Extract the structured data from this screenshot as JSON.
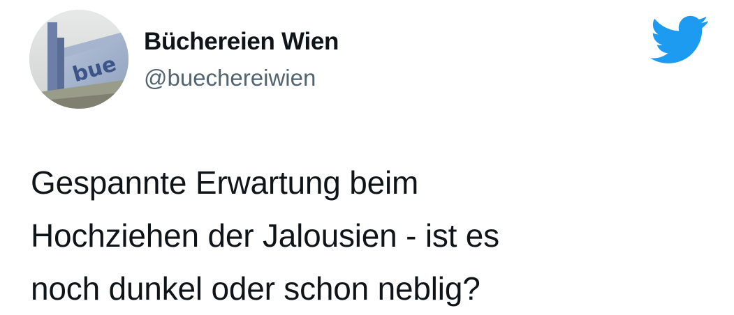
{
  "author": {
    "display_name": "Büchereien Wien",
    "handle": "@buechereiwien"
  },
  "tweet": {
    "lines": [
      "Gespannte Erwartung beim",
      "Hochziehen der Jalousien - ist es",
      "noch dunkel oder schon neblig?"
    ]
  },
  "icons": {
    "brand": "twitter-bird-icon",
    "brand_color": "#1d9bf0"
  }
}
